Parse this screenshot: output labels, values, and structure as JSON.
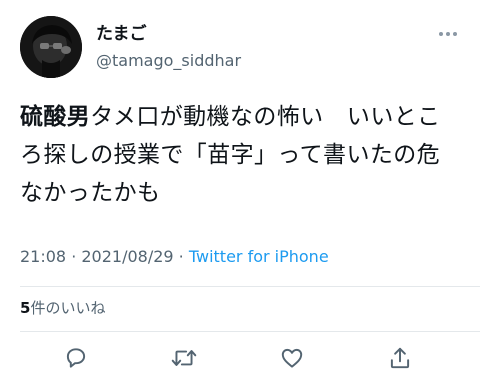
{
  "author": {
    "display_name": "たまご",
    "handle": "@tamago_siddhar"
  },
  "tweet": {
    "text": "硫酸男タメ口が動機なの怖い　いいところ探しの授業で「苗字」って書いたの危なかったかも",
    "bold_prefix": "硫酸男",
    "rest": "タメ口が動機なの怖い　いいところ探しの授業で「苗字」って書いたの危なかったかも"
  },
  "meta": {
    "time": "21:08",
    "separator1": " · ",
    "date": "2021/08/29",
    "separator2": " · ",
    "source": "Twitter for iPhone"
  },
  "engagement": {
    "like_count": "5",
    "like_label": "件のいいね"
  },
  "icons": {
    "more": "more-horizontal-icon",
    "reply": "reply-icon",
    "retweet": "retweet-icon",
    "like": "heart-icon",
    "share": "share-icon"
  },
  "colors": {
    "text_primary": "#0f1419",
    "text_secondary": "#536471",
    "link": "#1d9bf0",
    "divider": "#e4e8eb"
  }
}
